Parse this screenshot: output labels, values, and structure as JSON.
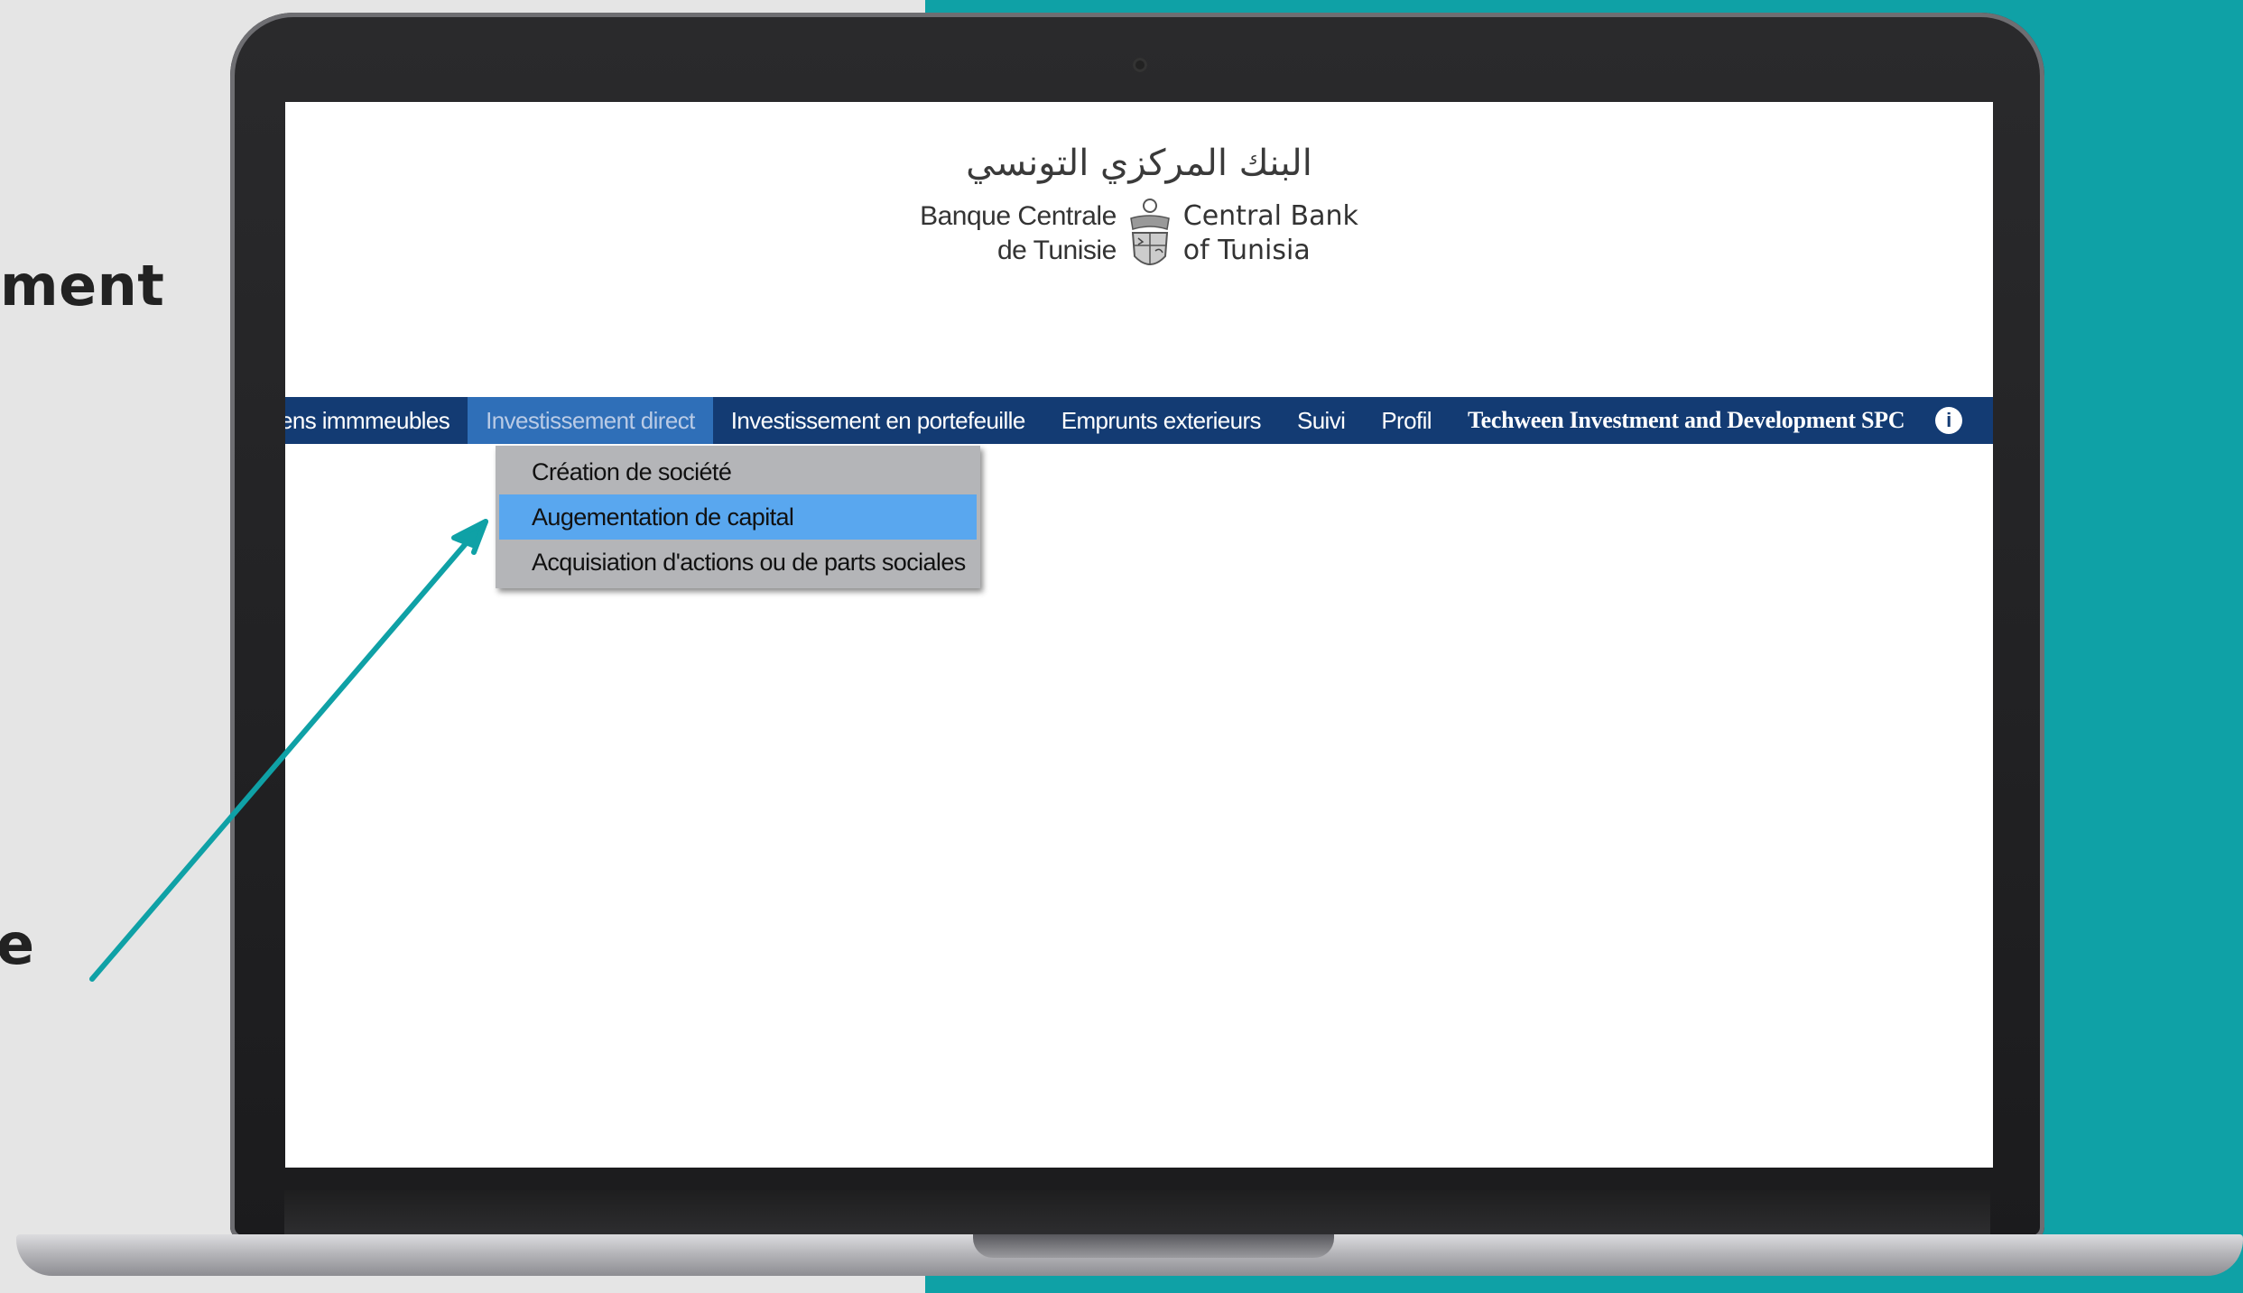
{
  "slide": {
    "partial_heading": "ment",
    "partial_letter": "e"
  },
  "brand": {
    "arabic_name": "البنك المركزي التونسي",
    "name_fr_line1": "Banque Centrale",
    "name_fr_line2": "de Tunisie",
    "name_en_line1": "Central Bank",
    "name_en_line2": "of Tunisia"
  },
  "navbar": {
    "items": [
      {
        "label": "ens immmeubles"
      },
      {
        "label": "Investissement direct"
      },
      {
        "label": "Investissement en portefeuille"
      },
      {
        "label": "Emprunts exterieurs"
      },
      {
        "label": "Suivi"
      },
      {
        "label": "Profil"
      },
      {
        "label": "Techween Investment and Development SPC"
      }
    ],
    "info_icon": "info-icon"
  },
  "dropdown": {
    "items": [
      {
        "label": "Création de société"
      },
      {
        "label": "Augementation de capital"
      },
      {
        "label": "Acquisiation d'actions ou de parts sociales"
      }
    ]
  },
  "colors": {
    "teal": "#0fa1a6",
    "navbar": "#133b73",
    "nav_active": "#2f6fb8",
    "menu_highlight": "#59a7ef"
  }
}
